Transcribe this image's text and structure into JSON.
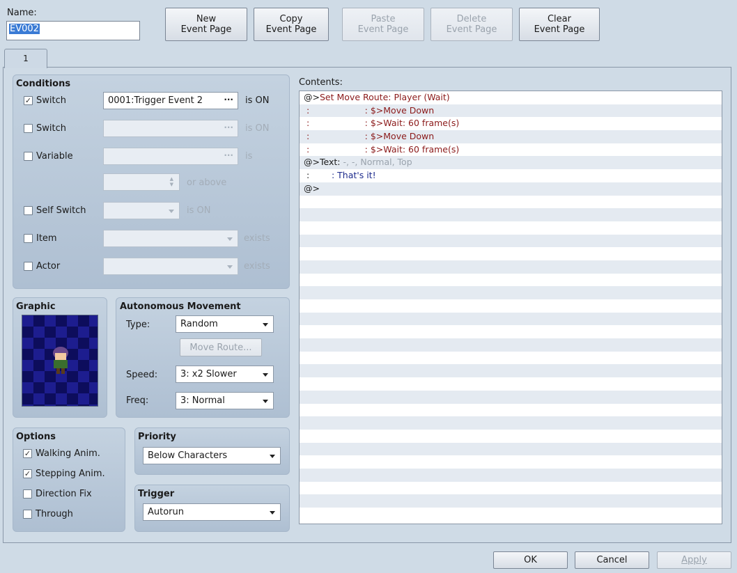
{
  "name": {
    "label": "Name:",
    "value": "EV002"
  },
  "toolbar": {
    "new": "New\nEvent Page",
    "copy": "Copy\nEvent Page",
    "paste": "Paste\nEvent Page",
    "delete": "Delete\nEvent Page",
    "clear": "Clear\nEvent Page"
  },
  "tab": "1",
  "conditions": {
    "title": "Conditions",
    "switch1": {
      "label": "Switch",
      "value": "0001:Trigger Event 2",
      "suffix": "is ON",
      "checked": true
    },
    "switch2": {
      "label": "Switch",
      "suffix": "is ON",
      "checked": false
    },
    "variable": {
      "label": "Variable",
      "suffix": "is",
      "or_above": "or above",
      "checked": false
    },
    "self_switch": {
      "label": "Self Switch",
      "suffix": "is ON",
      "checked": false
    },
    "item": {
      "label": "Item",
      "suffix": "exists",
      "checked": false
    },
    "actor": {
      "label": "Actor",
      "suffix": "exists",
      "checked": false
    }
  },
  "graphic": {
    "title": "Graphic"
  },
  "movement": {
    "title": "Autonomous Movement",
    "type_label": "Type:",
    "type_value": "Random",
    "move_route": "Move Route...",
    "speed_label": "Speed:",
    "speed_value": "3: x2 Slower",
    "freq_label": "Freq:",
    "freq_value": "3: Normal"
  },
  "options": {
    "title": "Options",
    "items": [
      {
        "label": "Walking Anim.",
        "checked": true
      },
      {
        "label": "Stepping Anim.",
        "checked": true
      },
      {
        "label": "Direction Fix",
        "checked": false
      },
      {
        "label": "Through",
        "checked": false
      }
    ]
  },
  "priority": {
    "title": "Priority",
    "value": "Below Characters"
  },
  "trigger": {
    "title": "Trigger",
    "value": "Autorun"
  },
  "contents": {
    "label": "Contents:",
    "lines": [
      [
        {
          "t": "@>",
          "c": "#1a1a1a"
        },
        {
          "t": "Set Move Route: Player (Wait)",
          "c": "#8b1a1a"
        }
      ],
      [
        {
          "t": " :                    : $>Move Down",
          "c": "#8b1a1a"
        }
      ],
      [
        {
          "t": " :                    : $>Wait: 60 frame(s)",
          "c": "#8b1a1a"
        }
      ],
      [
        {
          "t": " :                    : $>Move Down",
          "c": "#8b1a1a"
        }
      ],
      [
        {
          "t": " :                    : $>Wait: 60 frame(s)",
          "c": "#8b1a1a"
        }
      ],
      [
        {
          "t": "@>Text: ",
          "c": "#1a1a1a"
        },
        {
          "t": "-, -, Normal, Top",
          "c": "#9aa3ad"
        }
      ],
      [
        {
          "t": " :        ",
          "c": "#1a1a1a"
        },
        {
          "t": ": That's it!",
          "c": "#1c2a8c"
        }
      ],
      [
        {
          "t": "@>",
          "c": "#1a1a1a"
        }
      ]
    ]
  },
  "footer": {
    "ok": "OK",
    "cancel": "Cancel",
    "apply": "Apply"
  }
}
